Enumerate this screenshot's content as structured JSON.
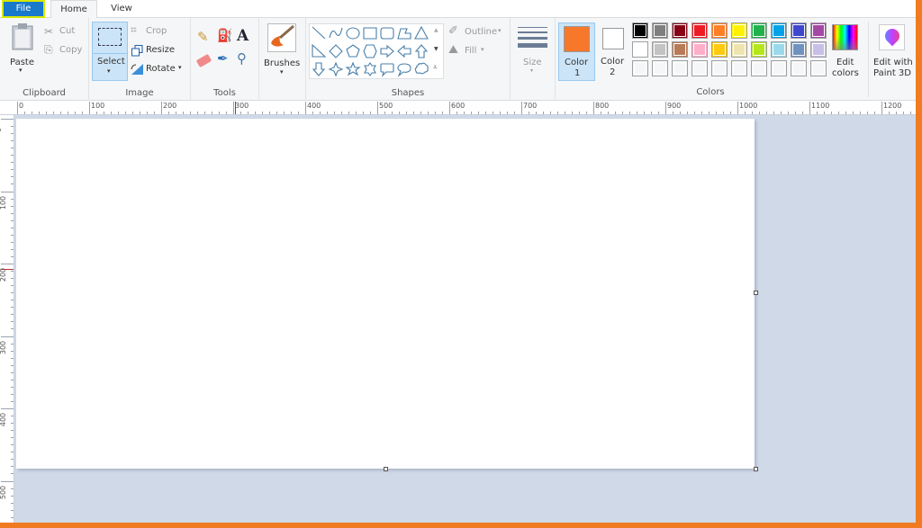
{
  "tabs": {
    "file": "File",
    "home": "Home",
    "view": "View"
  },
  "clipboard": {
    "paste": "Paste",
    "cut": "Cut",
    "copy": "Copy",
    "group": "Clipboard"
  },
  "image": {
    "select": "Select",
    "crop": "Crop",
    "resize": "Resize",
    "rotate": "Rotate",
    "group": "Image"
  },
  "tools": {
    "group": "Tools",
    "items": [
      "pencil",
      "fill",
      "text",
      "eraser",
      "color-picker",
      "magnifier"
    ]
  },
  "brushes": {
    "label": "Brushes"
  },
  "shapes": {
    "group": "Shapes",
    "outline": "Outline",
    "fill": "Fill",
    "items": [
      "line",
      "curve",
      "oval",
      "rectangle",
      "rounded-rectangle",
      "polygon",
      "triangle",
      "right-triangle",
      "diamond",
      "pentagon",
      "hexagon",
      "right-arrow",
      "left-arrow",
      "up-arrow",
      "down-arrow",
      "four-point-star",
      "five-point-star",
      "six-point-star",
      "rounded-callout",
      "oval-callout",
      "cloud-callout"
    ]
  },
  "size": {
    "label": "Size"
  },
  "color1": {
    "line1": "Color",
    "line2": "1",
    "value": "#f7782a"
  },
  "color2": {
    "line1": "Color",
    "line2": "2",
    "value": "#ffffff"
  },
  "colors": {
    "group": "Colors",
    "row1": [
      "#000000",
      "#7f7f7f",
      "#880015",
      "#ed1c24",
      "#ff7f27",
      "#fff200",
      "#22b14c",
      "#00a2e8",
      "#3f48cc",
      "#a349a4"
    ],
    "row2": [
      "#ffffff",
      "#c3c3c3",
      "#b97a57",
      "#ffaec9",
      "#ffc90e",
      "#efe4b0",
      "#b5e61d",
      "#99d9ea",
      "#7092be",
      "#c8bfe7"
    ],
    "row3": [
      "",
      "",
      "",
      "",
      "",
      "",
      "",
      "",
      "",
      ""
    ]
  },
  "edit_colors": {
    "line1": "Edit",
    "line2": "colors"
  },
  "paint3d": {
    "line1": "Edit with",
    "line2": "Paint 3D"
  },
  "ruler_h": [
    "0",
    "100",
    "200",
    "300",
    "400",
    "500",
    "600",
    "700",
    "800",
    "900",
    "1000",
    "1100",
    "1200"
  ],
  "ruler_v": [
    "0",
    "100",
    "200",
    "300",
    "400",
    "500"
  ]
}
